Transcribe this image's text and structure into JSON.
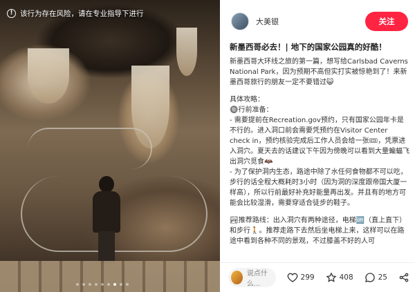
{
  "photo": {
    "warning_text": "该行为存在风险，请在专业指导下进行",
    "warning_icon": "exclamation-circle-icon",
    "slide_count": 9,
    "active_slide": 7
  },
  "author": {
    "name": "大美银",
    "follow_label": "关注",
    "follow_color": "#ff2442"
  },
  "note": {
    "title": "新墨西哥必去！| 地下的国家公园真的好酷！",
    "intro": "新墨西哥大环线之旅的第一篇，想写给Carlsbad Caverns National Park，因为预期不高但实打实被惊艳到了！来新墨西哥旅行的朋友一定不要错过😺",
    "guide_heading": "具体攻略：",
    "prep_heading": "🔘行前准备：",
    "prep_1": "- 需要提前在Recreation.gov预约，只有国家公园年卡是不行的。进入洞口前会需要凭预约在Visitor Center check in，预约核验完成后工作人员会给一张🎟，凭票进入洞穴。夏天去的话建议下午因为傍晚可以看到大量蝙蝠飞出洞穴觅食🦇",
    "prep_2": "- 为了保护洞内生态，路途中除了水任何食物都不可以吃，步行的话全程大概耗时3小时（因为洞的深度跟帝国大厦一样高），所以行前最好补充好能量再出发。并且有的地方可能会比较湿滑，需要穿适合徒步的鞋子。",
    "route": "🏞推荐路线：出入洞穴有两种途径，电梯🆙（直上直下）和步行🚶。推荐走路下去然后坐电梯上来，这样可以在路途中看到各种不同的景观，不过膝盖不好的人可"
  },
  "bottom_bar": {
    "comment_placeholder": "说点什么...",
    "likes": "299",
    "stars": "408",
    "comments": "25"
  }
}
